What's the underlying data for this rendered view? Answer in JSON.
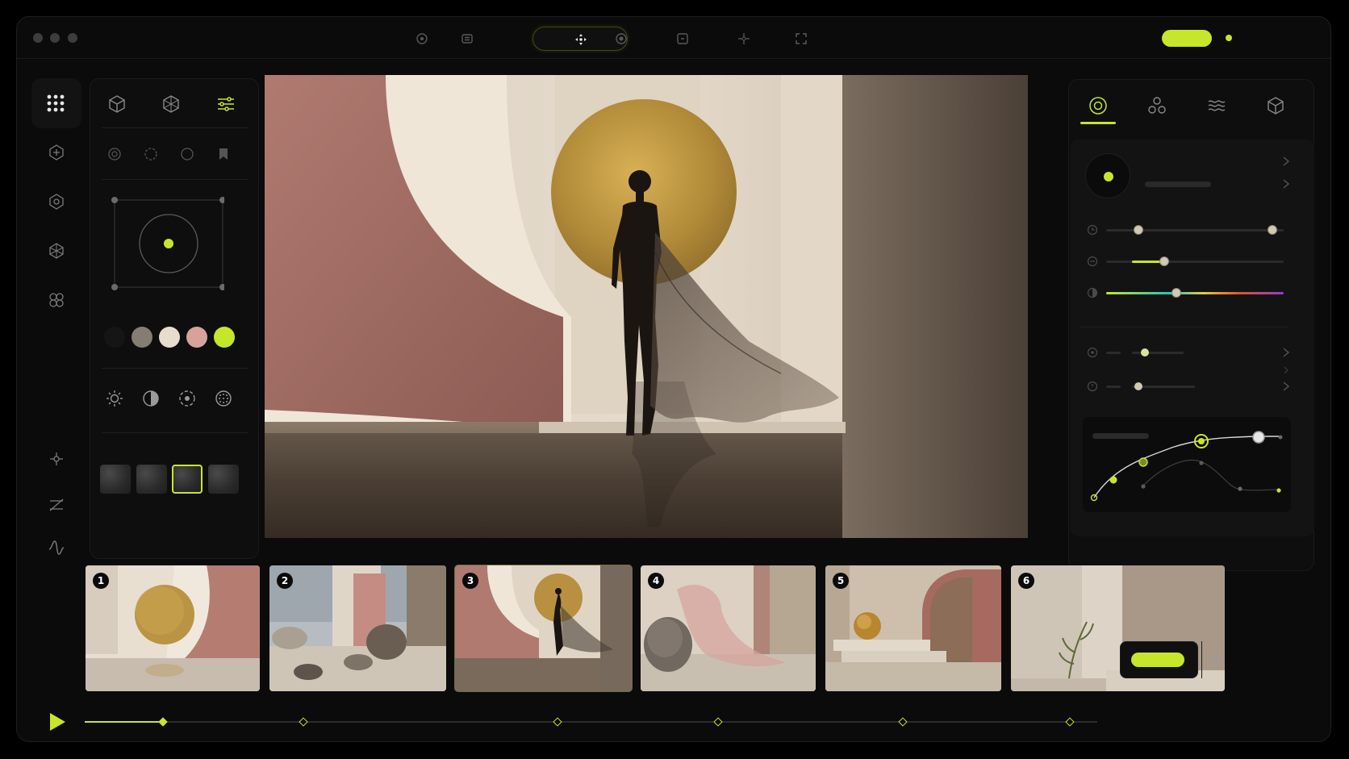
{
  "titlebar": {
    "traffic_lights": [
      "close",
      "minimize",
      "maximize"
    ],
    "toolbar_icons": [
      "target-icon",
      "list-icon",
      "move-icon",
      "record-icon",
      "frame-icon",
      "crosshair-icon",
      "fullscreen-icon"
    ],
    "active_tool": "move-icon",
    "export_pill": "",
    "status": "online"
  },
  "colors": {
    "accent": "#c6e62c",
    "background": "#0b0b0b",
    "panel": "#0e0e0e",
    "card": "#131313"
  },
  "left_rail": {
    "top_icons": [
      "grid-icon",
      "move-3d-icon",
      "rotate-3d-icon",
      "scale-3d-icon",
      "link-icon"
    ],
    "bottom_icons": [
      "pivot-icon",
      "slope-icon",
      "waveform-icon"
    ]
  },
  "left_panel": {
    "tabs": [
      "cube-icon",
      "mesh-icon",
      "sliders-icon"
    ],
    "active_tab": "sliders-icon",
    "mini_tools": [
      "aperture-icon",
      "dashed-circle-icon",
      "circle-icon",
      "bookmark-icon"
    ],
    "swatches": [
      "#151515",
      "#857d73",
      "#e7dccd",
      "#d8a29a",
      "#c6e62c"
    ],
    "light_icons": [
      "sun-icon",
      "contrast-icon",
      "focus-icon",
      "noise-icon"
    ],
    "textures_selected": 3
  },
  "right_panel": {
    "tabs": [
      "target-icon",
      "nodes-icon",
      "waves-icon",
      "box-icon"
    ],
    "active_tab": "target-icon",
    "sliders": [
      {
        "icon": "clock-icon",
        "value": 0.18
      },
      {
        "icon": "blur-icon",
        "value": 0.33
      },
      {
        "icon": "hue-icon",
        "value": 0.39
      }
    ],
    "mini_sliders": [
      {
        "icon": "dial-icon",
        "value": 0.26
      },
      {
        "icon": "timer-icon",
        "value": 0.18
      }
    ]
  },
  "filmstrip": {
    "scenes": [
      {
        "num": "1"
      },
      {
        "num": "2"
      },
      {
        "num": "3"
      },
      {
        "num": "4"
      },
      {
        "num": "5"
      },
      {
        "num": "6"
      }
    ],
    "active_scene": 3
  },
  "timeline": {
    "playhead": 0.078,
    "add_label": "+"
  }
}
